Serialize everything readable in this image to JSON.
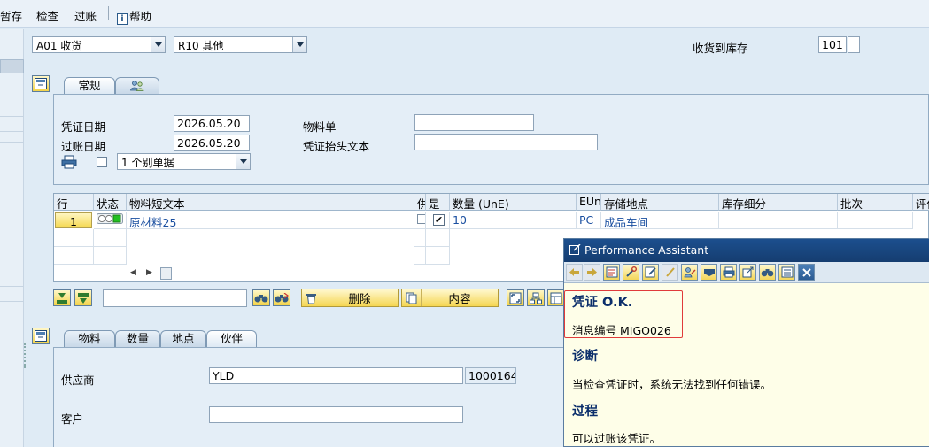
{
  "menu": {
    "save_draft": "暂存",
    "check": "检查",
    "post": "过账",
    "help_icon": "i",
    "help": "帮助"
  },
  "header": {
    "action": "A01 收货",
    "reference": "R10 其他",
    "movement_label": "收货到库存",
    "movement_type": "101"
  },
  "tabs_top": {
    "general": "常规",
    "partner_icon": "people-icon"
  },
  "general": {
    "doc_date_label": "凭证日期",
    "doc_date": "2026.05.20",
    "post_date_label": "过账日期",
    "post_date": "2026.05.20",
    "material_slip_label": "物料单",
    "material_slip": "",
    "header_text_label": "凭证抬头文本",
    "header_text": "",
    "print_option": "1 个别单据"
  },
  "grid": {
    "columns": [
      "行",
      "状态",
      "物料短文本",
      "供",
      "是",
      "数量 (UnE)",
      "EUn",
      "存储地点",
      "库存细分",
      "批次",
      "评估"
    ],
    "rows": [
      {
        "line": "1",
        "material_text": "原材料25",
        "checked": "✔",
        "quantity": "10",
        "unit": "PC",
        "storage_location": "成品车间"
      }
    ]
  },
  "toolbar": {
    "delete": "删除",
    "content": "内容",
    "search_value": ""
  },
  "tabs_bottom": {
    "material": "物料",
    "quantity": "数量",
    "location": "地点",
    "partner": "伙伴"
  },
  "partner": {
    "vendor_label": "供应商",
    "vendor_name": "YLD",
    "vendor_number": "1000164",
    "customer_label": "客户",
    "customer_value": ""
  },
  "performance_assistant": {
    "title": "Performance Assistant",
    "heading": "凭证 O.K.",
    "message_no": "消息编号 MIGO026",
    "diagnosis_heading": "诊断",
    "diagnosis_text": "当检查凭证时，系统无法找到任何错误。",
    "procedure_heading": "过程",
    "procedure_text": "可以过账该凭证。"
  }
}
